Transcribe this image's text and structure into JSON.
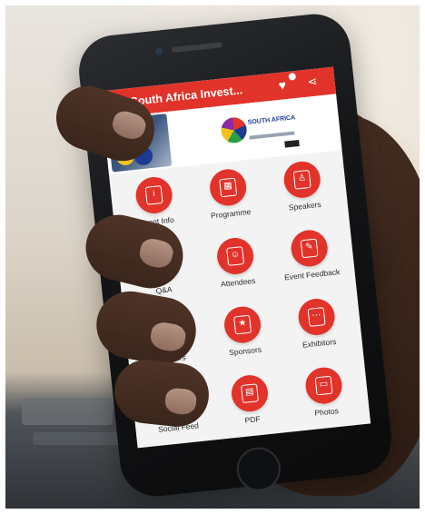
{
  "app": {
    "title": "South Africa Invest...",
    "banner_logo_text": "SOUTH AFRICA"
  },
  "icons": {
    "menu": "hamburger-menu-icon",
    "favorite": "heart-icon",
    "share": "share-icon"
  },
  "colors": {
    "accent": "#e2332b",
    "appbar_text": "#ffffff",
    "tile_label": "#2c2c2c"
  },
  "grid": {
    "tiles": [
      {
        "label": "Event Info",
        "icon": "info-document-icon"
      },
      {
        "label": "Programme",
        "icon": "calendar-icon"
      },
      {
        "label": "Speakers",
        "icon": "speaker-podium-icon"
      },
      {
        "label": "Q&A",
        "icon": "question-answer-icon"
      },
      {
        "label": "Attendees",
        "icon": "people-icon"
      },
      {
        "label": "Event Feedback",
        "icon": "feedback-icon"
      },
      {
        "label": "Partners",
        "icon": "handshake-icon"
      },
      {
        "label": "Sponsors",
        "icon": "sponsor-badge-icon"
      },
      {
        "label": "Exhibitors",
        "icon": "exhibition-icon"
      },
      {
        "label": "Social Feed",
        "icon": "chat-bubble-icon"
      },
      {
        "label": "PDF",
        "icon": "pdf-document-icon"
      },
      {
        "label": "Photos",
        "icon": "presentation-icon"
      }
    ]
  }
}
